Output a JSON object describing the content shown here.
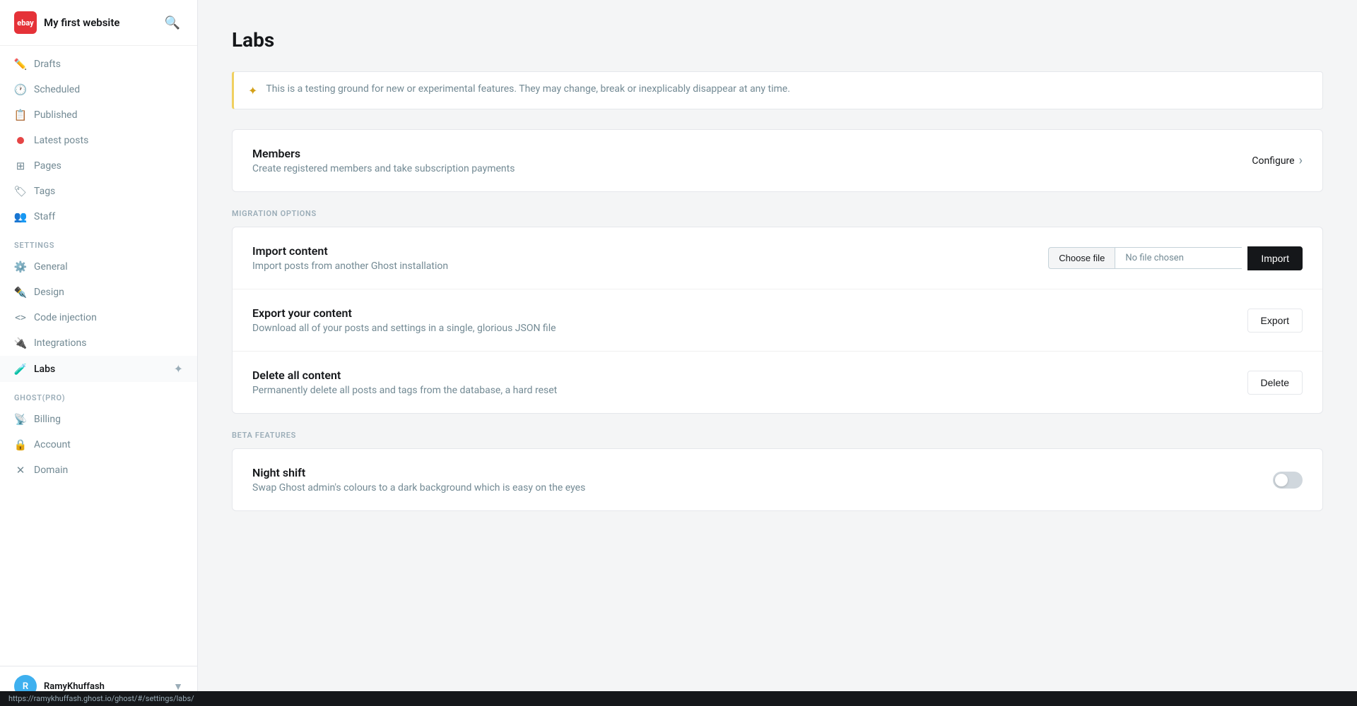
{
  "brand": {
    "logo_text": "ebay",
    "site_name": "My first website"
  },
  "sidebar": {
    "sections": [
      {
        "items": [
          {
            "id": "drafts",
            "label": "Drafts",
            "icon": "✏️",
            "active": false
          },
          {
            "id": "scheduled",
            "label": "Scheduled",
            "icon": "🕐",
            "active": false
          },
          {
            "id": "published",
            "label": "Published",
            "icon": "📋",
            "active": false
          },
          {
            "id": "latest-posts",
            "label": "Latest posts",
            "icon": "dot",
            "active": false
          },
          {
            "id": "pages",
            "label": "Pages",
            "icon": "⊞",
            "active": false
          },
          {
            "id": "tags",
            "label": "Tags",
            "icon": "🏷",
            "active": false
          },
          {
            "id": "staff",
            "label": "Staff",
            "icon": "👥",
            "active": false
          }
        ]
      },
      {
        "label": "Settings",
        "items": [
          {
            "id": "general",
            "label": "General",
            "icon": "⚙️",
            "active": false
          },
          {
            "id": "design",
            "label": "Design",
            "icon": "✒️",
            "active": false
          },
          {
            "id": "code-injection",
            "label": "Code injection",
            "icon": "<>",
            "active": false
          },
          {
            "id": "integrations",
            "label": "Integrations",
            "icon": "🔌",
            "active": false
          },
          {
            "id": "labs",
            "label": "Labs",
            "icon": "🧪",
            "active": true
          }
        ]
      },
      {
        "label": "Ghost(Pro)",
        "items": [
          {
            "id": "billing",
            "label": "Billing",
            "icon": "📡",
            "active": false
          },
          {
            "id": "account",
            "label": "Account",
            "icon": "🔒",
            "active": false
          },
          {
            "id": "domain",
            "label": "Domain",
            "icon": "✕",
            "active": false
          }
        ]
      }
    ],
    "user": {
      "name": "RamyKhuffash",
      "avatar_initials": "R",
      "url": "https://ramykhuffash.ghost.io/ghost/#/settings/labs/"
    }
  },
  "main": {
    "title": "Labs",
    "info_banner": "This is a testing ground for new or experimental features. They may change, break or inexplicably disappear at any time.",
    "members_section": {
      "title": "Members",
      "description": "Create registered members and take subscription payments",
      "configure_label": "Configure"
    },
    "migration_section_label": "Migration Options",
    "migration_items": [
      {
        "title": "Import content",
        "description": "Import posts from another Ghost installation",
        "action_label": "Import",
        "file_choose_label": "Choose file",
        "file_no_file": "No file chosen"
      },
      {
        "title": "Export your content",
        "description": "Download all of your posts and settings in a single, glorious JSON file",
        "action_label": "Export"
      },
      {
        "title": "Delete all content",
        "description": "Permanently delete all posts and tags from the database, a hard reset",
        "action_label": "Delete"
      }
    ],
    "beta_section_label": "Beta Features",
    "beta_items": [
      {
        "title": "Night shift",
        "description": "Swap Ghost admin's colours to a dark background which is easy on the eyes",
        "toggle": false
      }
    ]
  },
  "status_bar": {
    "url": "https://ramykhuffash.ghost.io/ghost/#/settings/labs/"
  }
}
